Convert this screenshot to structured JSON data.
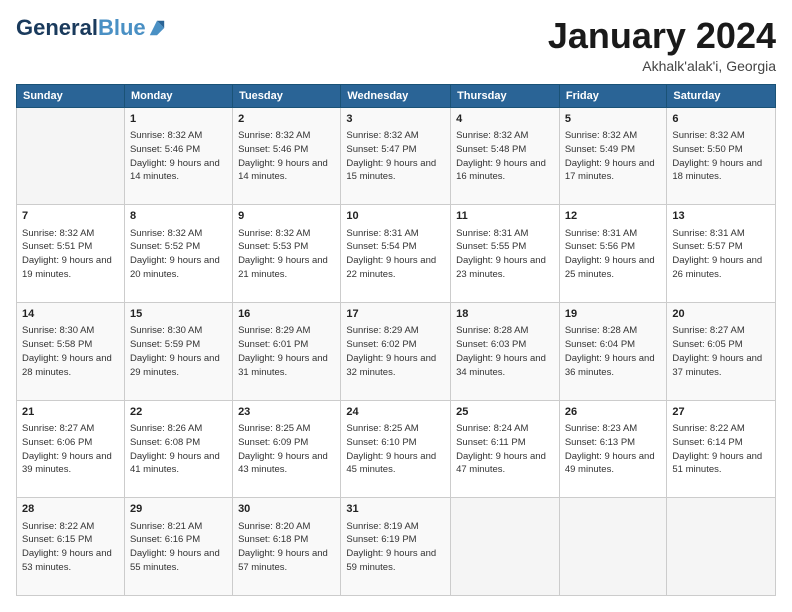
{
  "header": {
    "logo_line1": "General",
    "logo_line2": "Blue",
    "month_title": "January 2024",
    "subtitle": "Akhalk'alak'i, Georgia"
  },
  "days_of_week": [
    "Sunday",
    "Monday",
    "Tuesday",
    "Wednesday",
    "Thursday",
    "Friday",
    "Saturday"
  ],
  "weeks": [
    [
      {
        "day": "",
        "sunrise": "",
        "sunset": "",
        "daylight": ""
      },
      {
        "day": "1",
        "sunrise": "Sunrise: 8:32 AM",
        "sunset": "Sunset: 5:46 PM",
        "daylight": "Daylight: 9 hours and 14 minutes."
      },
      {
        "day": "2",
        "sunrise": "Sunrise: 8:32 AM",
        "sunset": "Sunset: 5:46 PM",
        "daylight": "Daylight: 9 hours and 14 minutes."
      },
      {
        "day": "3",
        "sunrise": "Sunrise: 8:32 AM",
        "sunset": "Sunset: 5:47 PM",
        "daylight": "Daylight: 9 hours and 15 minutes."
      },
      {
        "day": "4",
        "sunrise": "Sunrise: 8:32 AM",
        "sunset": "Sunset: 5:48 PM",
        "daylight": "Daylight: 9 hours and 16 minutes."
      },
      {
        "day": "5",
        "sunrise": "Sunrise: 8:32 AM",
        "sunset": "Sunset: 5:49 PM",
        "daylight": "Daylight: 9 hours and 17 minutes."
      },
      {
        "day": "6",
        "sunrise": "Sunrise: 8:32 AM",
        "sunset": "Sunset: 5:50 PM",
        "daylight": "Daylight: 9 hours and 18 minutes."
      }
    ],
    [
      {
        "day": "7",
        "sunrise": "Sunrise: 8:32 AM",
        "sunset": "Sunset: 5:51 PM",
        "daylight": "Daylight: 9 hours and 19 minutes."
      },
      {
        "day": "8",
        "sunrise": "Sunrise: 8:32 AM",
        "sunset": "Sunset: 5:52 PM",
        "daylight": "Daylight: 9 hours and 20 minutes."
      },
      {
        "day": "9",
        "sunrise": "Sunrise: 8:32 AM",
        "sunset": "Sunset: 5:53 PM",
        "daylight": "Daylight: 9 hours and 21 minutes."
      },
      {
        "day": "10",
        "sunrise": "Sunrise: 8:31 AM",
        "sunset": "Sunset: 5:54 PM",
        "daylight": "Daylight: 9 hours and 22 minutes."
      },
      {
        "day": "11",
        "sunrise": "Sunrise: 8:31 AM",
        "sunset": "Sunset: 5:55 PM",
        "daylight": "Daylight: 9 hours and 23 minutes."
      },
      {
        "day": "12",
        "sunrise": "Sunrise: 8:31 AM",
        "sunset": "Sunset: 5:56 PM",
        "daylight": "Daylight: 9 hours and 25 minutes."
      },
      {
        "day": "13",
        "sunrise": "Sunrise: 8:31 AM",
        "sunset": "Sunset: 5:57 PM",
        "daylight": "Daylight: 9 hours and 26 minutes."
      }
    ],
    [
      {
        "day": "14",
        "sunrise": "Sunrise: 8:30 AM",
        "sunset": "Sunset: 5:58 PM",
        "daylight": "Daylight: 9 hours and 28 minutes."
      },
      {
        "day": "15",
        "sunrise": "Sunrise: 8:30 AM",
        "sunset": "Sunset: 5:59 PM",
        "daylight": "Daylight: 9 hours and 29 minutes."
      },
      {
        "day": "16",
        "sunrise": "Sunrise: 8:29 AM",
        "sunset": "Sunset: 6:01 PM",
        "daylight": "Daylight: 9 hours and 31 minutes."
      },
      {
        "day": "17",
        "sunrise": "Sunrise: 8:29 AM",
        "sunset": "Sunset: 6:02 PM",
        "daylight": "Daylight: 9 hours and 32 minutes."
      },
      {
        "day": "18",
        "sunrise": "Sunrise: 8:28 AM",
        "sunset": "Sunset: 6:03 PM",
        "daylight": "Daylight: 9 hours and 34 minutes."
      },
      {
        "day": "19",
        "sunrise": "Sunrise: 8:28 AM",
        "sunset": "Sunset: 6:04 PM",
        "daylight": "Daylight: 9 hours and 36 minutes."
      },
      {
        "day": "20",
        "sunrise": "Sunrise: 8:27 AM",
        "sunset": "Sunset: 6:05 PM",
        "daylight": "Daylight: 9 hours and 37 minutes."
      }
    ],
    [
      {
        "day": "21",
        "sunrise": "Sunrise: 8:27 AM",
        "sunset": "Sunset: 6:06 PM",
        "daylight": "Daylight: 9 hours and 39 minutes."
      },
      {
        "day": "22",
        "sunrise": "Sunrise: 8:26 AM",
        "sunset": "Sunset: 6:08 PM",
        "daylight": "Daylight: 9 hours and 41 minutes."
      },
      {
        "day": "23",
        "sunrise": "Sunrise: 8:25 AM",
        "sunset": "Sunset: 6:09 PM",
        "daylight": "Daylight: 9 hours and 43 minutes."
      },
      {
        "day": "24",
        "sunrise": "Sunrise: 8:25 AM",
        "sunset": "Sunset: 6:10 PM",
        "daylight": "Daylight: 9 hours and 45 minutes."
      },
      {
        "day": "25",
        "sunrise": "Sunrise: 8:24 AM",
        "sunset": "Sunset: 6:11 PM",
        "daylight": "Daylight: 9 hours and 47 minutes."
      },
      {
        "day": "26",
        "sunrise": "Sunrise: 8:23 AM",
        "sunset": "Sunset: 6:13 PM",
        "daylight": "Daylight: 9 hours and 49 minutes."
      },
      {
        "day": "27",
        "sunrise": "Sunrise: 8:22 AM",
        "sunset": "Sunset: 6:14 PM",
        "daylight": "Daylight: 9 hours and 51 minutes."
      }
    ],
    [
      {
        "day": "28",
        "sunrise": "Sunrise: 8:22 AM",
        "sunset": "Sunset: 6:15 PM",
        "daylight": "Daylight: 9 hours and 53 minutes."
      },
      {
        "day": "29",
        "sunrise": "Sunrise: 8:21 AM",
        "sunset": "Sunset: 6:16 PM",
        "daylight": "Daylight: 9 hours and 55 minutes."
      },
      {
        "day": "30",
        "sunrise": "Sunrise: 8:20 AM",
        "sunset": "Sunset: 6:18 PM",
        "daylight": "Daylight: 9 hours and 57 minutes."
      },
      {
        "day": "31",
        "sunrise": "Sunrise: 8:19 AM",
        "sunset": "Sunset: 6:19 PM",
        "daylight": "Daylight: 9 hours and 59 minutes."
      },
      {
        "day": "",
        "sunrise": "",
        "sunset": "",
        "daylight": ""
      },
      {
        "day": "",
        "sunrise": "",
        "sunset": "",
        "daylight": ""
      },
      {
        "day": "",
        "sunrise": "",
        "sunset": "",
        "daylight": ""
      }
    ]
  ]
}
